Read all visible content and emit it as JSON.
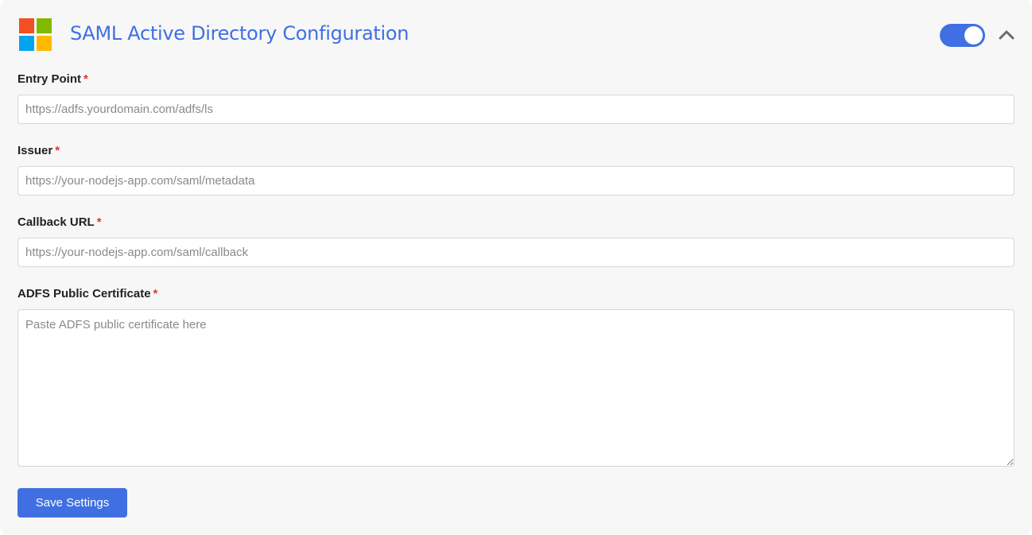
{
  "header": {
    "title": "SAML Active Directory Configuration",
    "logo_icon": "microsoft-logo-icon",
    "logo_colors": [
      "#f25022",
      "#7fba00",
      "#00a4ef",
      "#ffb900"
    ],
    "toggle_enabled": true,
    "collapse_icon": "chevron-up-icon"
  },
  "form": {
    "required_marker": "*",
    "entry_point": {
      "label": "Entry Point",
      "value": "",
      "placeholder": "https://adfs.yourdomain.com/adfs/ls"
    },
    "issuer": {
      "label": "Issuer",
      "value": "",
      "placeholder": "https://your-nodejs-app.com/saml/metadata"
    },
    "callback_url": {
      "label": "Callback URL",
      "value": "",
      "placeholder": "https://your-nodejs-app.com/saml/callback"
    },
    "certificate": {
      "label": "ADFS Public Certificate",
      "value": "",
      "placeholder": "Paste ADFS public certificate here"
    },
    "save_label": "Save Settings"
  },
  "colors": {
    "accent": "#3f6fe2",
    "required": "#e5312f",
    "panel_bg": "#f7f7f7"
  }
}
